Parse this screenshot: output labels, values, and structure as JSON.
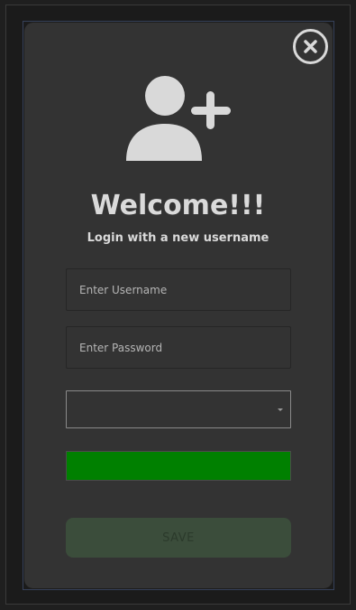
{
  "dialog": {
    "title": "Welcome!!!",
    "subtitle": "Login with a new username"
  },
  "form": {
    "username": {
      "placeholder": "Enter Username",
      "value": ""
    },
    "password": {
      "placeholder": "Enter Password",
      "value": ""
    },
    "select": {
      "selected": ""
    },
    "save_label": "SAVE"
  },
  "colors": {
    "accent_green": "#008000",
    "save_bg": "#3b4d3b",
    "save_text": "#2b3a2b",
    "icon": "#d9d9d9"
  },
  "icons": {
    "close": "close-circle-icon",
    "user": "user-add-icon",
    "caret": "caret-down-icon"
  }
}
